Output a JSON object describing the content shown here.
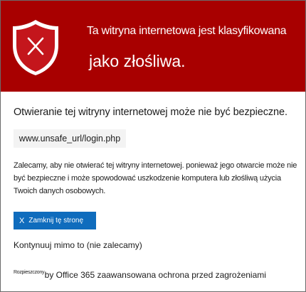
{
  "banner": {
    "line1": "Ta witryna internetowa jest klasyfikowana",
    "line2": "jako złośliwa.",
    "background_color": "#a80000",
    "icon": "shield-x-icon"
  },
  "warning": {
    "heading": "Otwieranie tej witryny internetowej może nie być bezpieczne.",
    "url": "www.unsafe_url/login.php",
    "description": "Zalecamy, aby nie otwierać tej witryny internetowej. ponieważ jego otwarcie może nie być bezpieczne i może spowodować uszkodzenie komputera lub złośliwą użycia Twoich danych osobowych."
  },
  "actions": {
    "close_label": "Zamknij tę stronę",
    "close_icon": "X",
    "close_color": "#0f6cbd",
    "continue_label": "Kontynuuj mimo to (nie zalecamy)"
  },
  "footer": {
    "prefix": "Rozpieszczony",
    "text": "by Office 365 zaawansowana ochrona przed zagrożeniami"
  }
}
